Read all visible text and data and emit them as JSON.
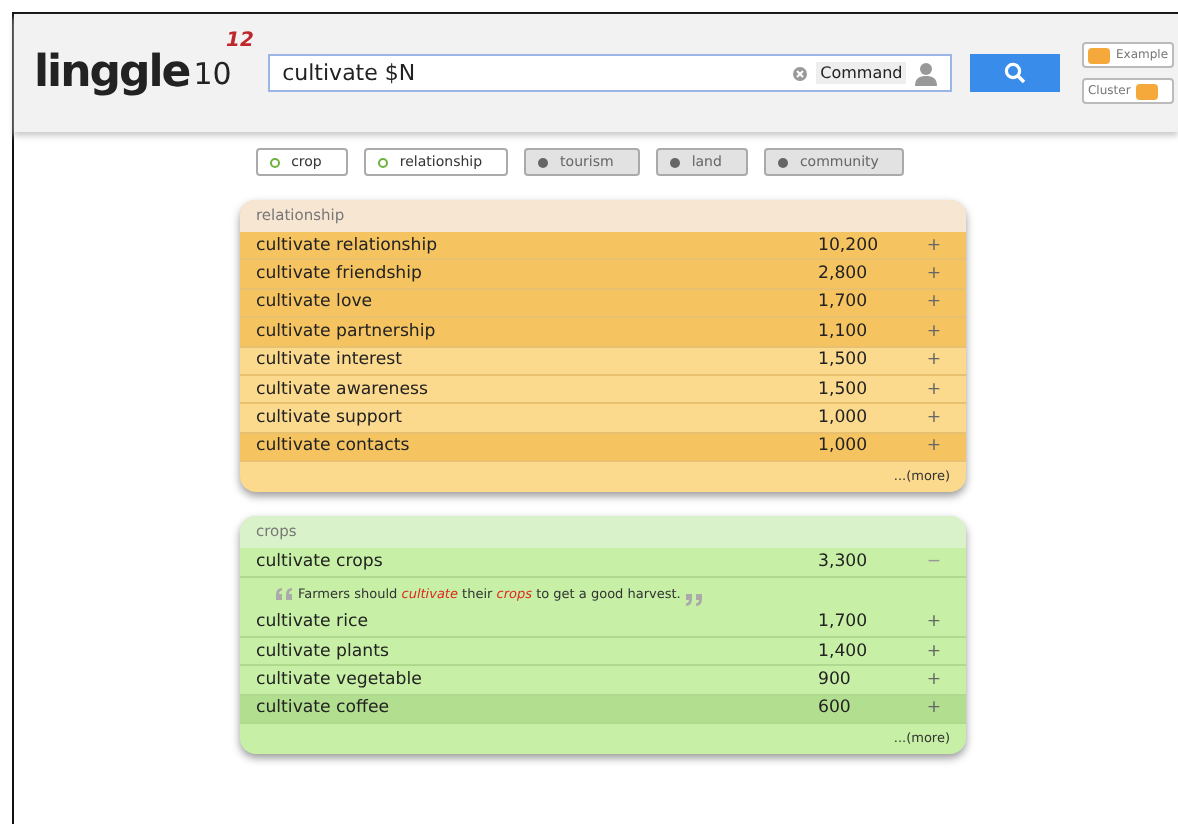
{
  "logo": {
    "name": "linggle",
    "version": "10",
    "superscript": "12"
  },
  "search": {
    "value": "cultivate $N",
    "command_label": "Command"
  },
  "toggles": [
    {
      "label": "Example",
      "on": true
    },
    {
      "label": "Cluster",
      "on": true
    }
  ],
  "filters": [
    {
      "label": "crop",
      "selected": true
    },
    {
      "label": "relationship",
      "selected": true
    },
    {
      "label": "tourism",
      "selected": false
    },
    {
      "label": "land",
      "selected": false
    },
    {
      "label": "community",
      "selected": false
    }
  ],
  "clusters": [
    {
      "title": "relationship",
      "kind": "orange",
      "more": "...(more)",
      "rows": [
        {
          "phrase": "cultivate relationship",
          "count": "10,200",
          "toggle": "+",
          "highlighted": true,
          "expanded": false
        },
        {
          "phrase": "cultivate friendship",
          "count": "2,800",
          "toggle": "+",
          "highlighted": true,
          "expanded": false
        },
        {
          "phrase": "cultivate love",
          "count": "1,700",
          "toggle": "+",
          "highlighted": true,
          "expanded": false
        },
        {
          "phrase": "cultivate partnership",
          "count": "1,100",
          "toggle": "+",
          "highlighted": true,
          "expanded": false
        },
        {
          "phrase": "cultivate interest",
          "count": "1,500",
          "toggle": "+",
          "highlighted": false,
          "expanded": false
        },
        {
          "phrase": "cultivate awareness",
          "count": "1,500",
          "toggle": "+",
          "highlighted": false,
          "expanded": false
        },
        {
          "phrase": "cultivate support",
          "count": "1,000",
          "toggle": "+",
          "highlighted": false,
          "expanded": false
        },
        {
          "phrase": "cultivate contacts",
          "count": "1,000",
          "toggle": "+",
          "highlighted": true,
          "expanded": false
        }
      ]
    },
    {
      "title": "crops",
      "kind": "green",
      "more": "...(more)",
      "rows": [
        {
          "phrase": "cultivate crops",
          "count": "3,300",
          "toggle": "−",
          "highlighted": false,
          "expanded": true,
          "example": "Farmers should *cultivate* their *crops* to get a good harvest."
        },
        {
          "phrase": "cultivate rice",
          "count": "1,700",
          "toggle": "+",
          "highlighted": false,
          "expanded": false
        },
        {
          "phrase": "cultivate plants",
          "count": "1,400",
          "toggle": "+",
          "highlighted": false,
          "expanded": false
        },
        {
          "phrase": "cultivate vegetable",
          "count": "900",
          "toggle": "+",
          "highlighted": false,
          "expanded": false
        },
        {
          "phrase": "cultivate coffee",
          "count": "600",
          "toggle": "+",
          "highlighted": true,
          "expanded": false
        }
      ]
    }
  ]
}
